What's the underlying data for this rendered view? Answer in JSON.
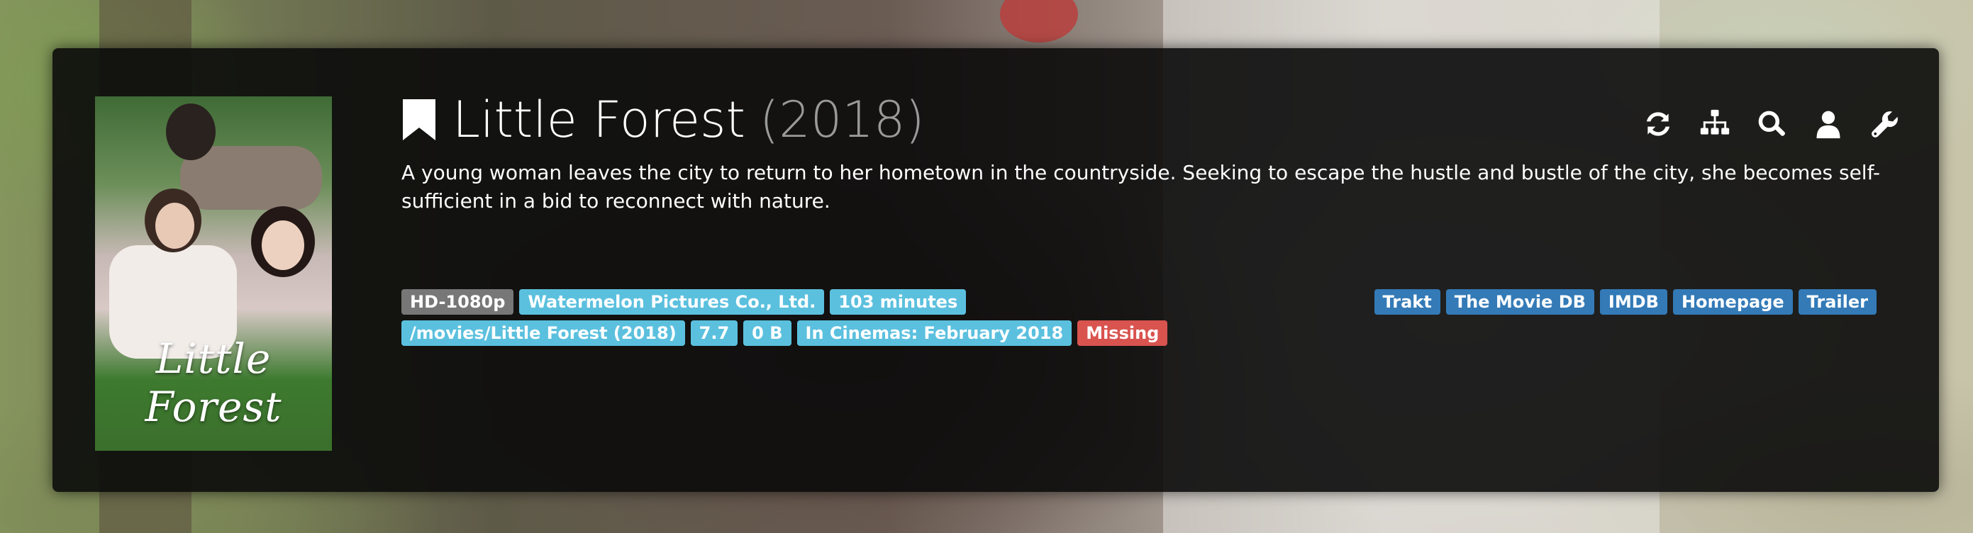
{
  "movie": {
    "title": "Little Forest",
    "year": "(2018)",
    "overview": "A young woman leaves the city to return to her hometown in the countryside. Seeking to escape the hustle and bustle of the city, she becomes self-sufficient in a bid to reconnect with nature.",
    "poster_title": "Little Forest"
  },
  "toolbar": {
    "icons": [
      "refresh-icon",
      "sitemap-icon",
      "search-icon",
      "user-icon",
      "wrench-icon"
    ]
  },
  "badges": {
    "quality": "HD-1080p",
    "studio": "Watermelon Pictures Co., Ltd.",
    "runtime": "103 minutes",
    "path": "/movies/Little Forest (2018)",
    "rating": "7.7",
    "size": "0 B",
    "release": "In Cinemas: February 2018",
    "status": "Missing"
  },
  "links": {
    "trakt": "Trakt",
    "tmdb": "The Movie DB",
    "imdb": "IMDB",
    "homepage": "Homepage",
    "trailer": "Trailer"
  },
  "colors": {
    "panel": "#0a0a0a",
    "badge_gray": "#777777",
    "badge_info": "#5bc0de",
    "badge_danger": "#d9534f",
    "badge_link": "#337ab7"
  }
}
